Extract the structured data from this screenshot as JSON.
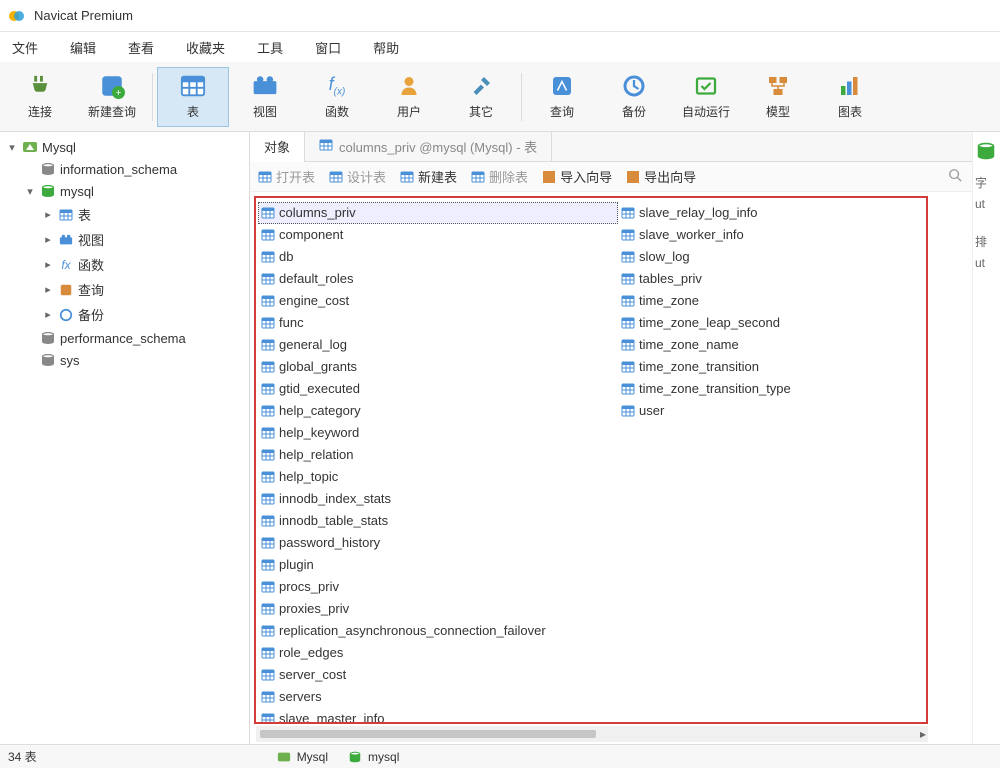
{
  "app": {
    "title": "Navicat Premium"
  },
  "menu": [
    "文件",
    "编辑",
    "查看",
    "收藏夹",
    "工具",
    "窗口",
    "帮助"
  ],
  "toolbar": [
    {
      "key": "connect",
      "label": "连接"
    },
    {
      "key": "newquery",
      "label": "新建查询"
    },
    {
      "key": "table",
      "label": "表",
      "active": true
    },
    {
      "key": "view",
      "label": "视图"
    },
    {
      "key": "function",
      "label": "函数"
    },
    {
      "key": "user",
      "label": "用户"
    },
    {
      "key": "other",
      "label": "其它"
    },
    {
      "key": "query",
      "label": "查询"
    },
    {
      "key": "backup",
      "label": "备份"
    },
    {
      "key": "autorun",
      "label": "自动运行"
    },
    {
      "key": "model",
      "label": "模型"
    },
    {
      "key": "chart",
      "label": "图表"
    }
  ],
  "tree": {
    "root": "Mysql",
    "dbs": [
      {
        "name": "information_schema",
        "expanded": false
      },
      {
        "name": "mysql",
        "expanded": true,
        "children": [
          {
            "name": "表",
            "icon": "table"
          },
          {
            "name": "视图",
            "icon": "view"
          },
          {
            "name": "函数",
            "icon": "fx"
          },
          {
            "name": "查询",
            "icon": "query"
          },
          {
            "name": "备份",
            "icon": "backup"
          }
        ]
      },
      {
        "name": "performance_schema",
        "expanded": false
      },
      {
        "name": "sys",
        "expanded": false
      }
    ]
  },
  "tabs": [
    {
      "label": "对象",
      "active": true
    },
    {
      "label": "columns_priv @mysql (Mysql) - 表",
      "active": false,
      "icon": "table"
    }
  ],
  "subtoolbar": [
    {
      "label": "打开表",
      "dim": true
    },
    {
      "label": "设计表",
      "dim": true
    },
    {
      "label": "新建表",
      "dim": false
    },
    {
      "label": "删除表",
      "dim": true
    },
    {
      "label": "导入向导",
      "dim": false
    },
    {
      "label": "导出向导",
      "dim": false
    }
  ],
  "tables_col_a": [
    "columns_priv",
    "component",
    "db",
    "default_roles",
    "engine_cost",
    "func",
    "general_log",
    "global_grants",
    "gtid_executed",
    "help_category",
    "help_keyword",
    "help_relation",
    "help_topic",
    "innodb_index_stats",
    "innodb_table_stats",
    "password_history",
    "plugin",
    "procs_priv",
    "proxies_priv",
    "replication_asynchronous_connection_failover",
    "role_edges",
    "server_cost",
    "servers",
    "slave_master_info"
  ],
  "tables_col_b": [
    "slave_relay_log_info",
    "slave_worker_info",
    "slow_log",
    "tables_priv",
    "time_zone",
    "time_zone_leap_second",
    "time_zone_name",
    "time_zone_transition",
    "time_zone_transition_type",
    "user"
  ],
  "right_panel": {
    "label1": "字",
    "value1": "ut",
    "label2": "排",
    "value2": "ut"
  },
  "statusbar": {
    "count": "34 表",
    "conn": "Mysql",
    "db": "mysql"
  }
}
